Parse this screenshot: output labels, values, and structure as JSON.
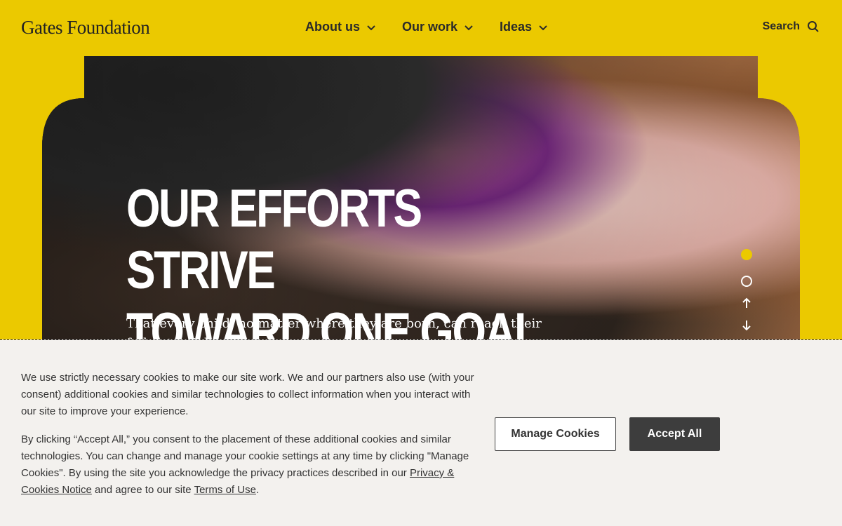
{
  "header": {
    "logo": "Gates Foundation",
    "nav": [
      {
        "label": "About us"
      },
      {
        "label": "Our work"
      },
      {
        "label": "Ideas"
      }
    ],
    "search_label": "Search"
  },
  "hero": {
    "title_line1": "OUR EFFORTS STRIVE",
    "title_line2": "TOWARD ONE GOAL",
    "subtitle": "That every child, no matter where they are born, can reach their full potential."
  },
  "cookie": {
    "paragraph1": "We use strictly necessary cookies to make our site work. We and our partners also use (with your consent) additional cookies and similar technologies to collect information when you interact with our site to improve your experience.",
    "paragraph2_a": "By clicking “Accept All,” you consent to the placement of these additional cookies and similar technologies. You can change and manage your cookie settings at any time by clicking \"Manage Cookies\". By using the site you acknowledge the privacy practices described in our ",
    "link_privacy": "Privacy & Cookies Notice",
    "paragraph2_b": " and agree to our site ",
    "link_terms": "Terms of Use",
    "paragraph2_c": ".",
    "manage_label": "Manage Cookies",
    "accept_label": "Accept All"
  },
  "colors": {
    "brand_yellow": "#ebc900",
    "banner_bg": "#f3f1ee",
    "accept_bg": "#3d3d3d"
  }
}
